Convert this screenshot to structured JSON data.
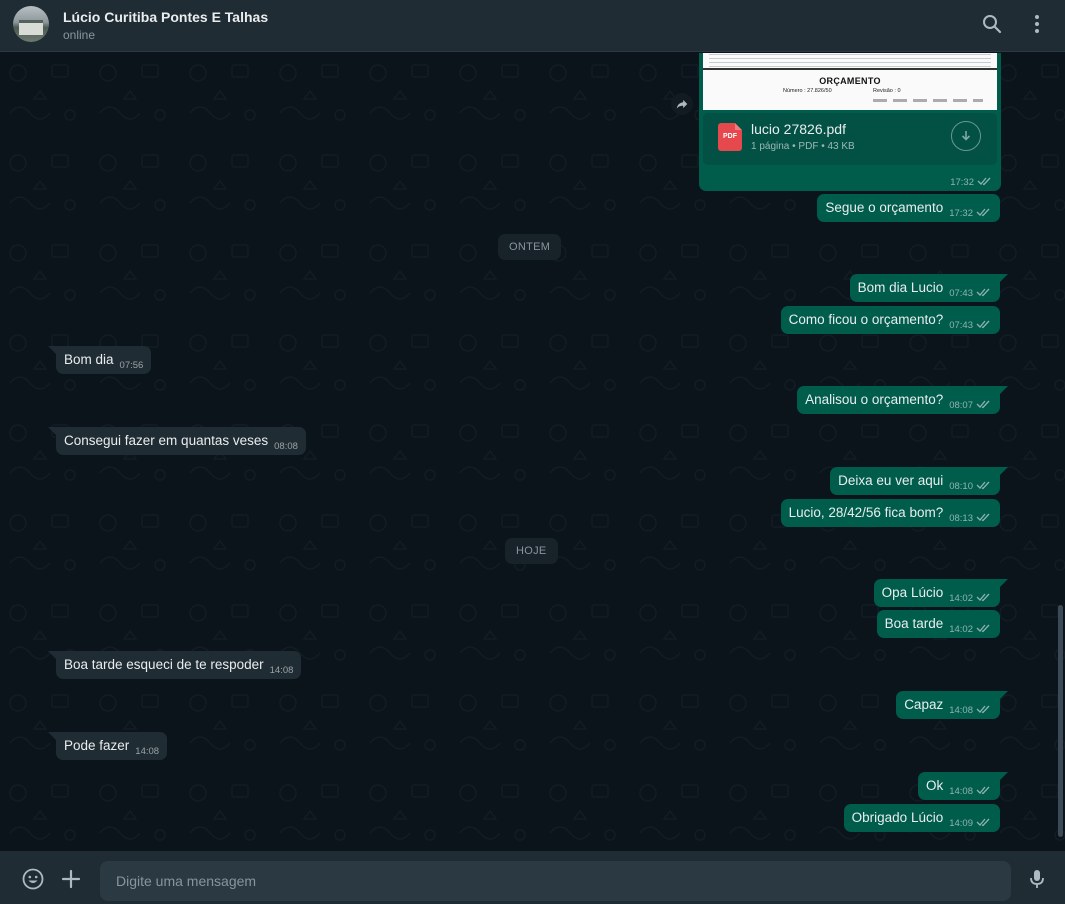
{
  "header": {
    "contact_name": "Lúcio Curitiba Pontes E Talhas",
    "contact_status": "online",
    "icons": [
      "search-icon",
      "menu-icon"
    ]
  },
  "colors": {
    "background": "#0b141a",
    "header": "#202c33",
    "outgoing_bubble": "#005c4b",
    "incoming_bubble": "#202c33",
    "read_ticks": "#53bdeb"
  },
  "document": {
    "preview_title": "ORÇAMENTO",
    "preview_number_label": "Número :",
    "preview_number": "27.826/50",
    "preview_revision_label": "Revisão :",
    "preview_revision": "0",
    "file_name": "lucio 27826.pdf",
    "file_info": "1 página • PDF • 43 KB",
    "icon_label": "PDF",
    "time": "17:32"
  },
  "messages": [
    {
      "text": "Segue o orçamento",
      "time": "17:32",
      "direction": "out"
    },
    {
      "text": "Bom dia Lucio",
      "time": "07:43",
      "direction": "out"
    },
    {
      "text": "Como ficou o orçamento?",
      "time": "07:43",
      "direction": "out"
    },
    {
      "text": "Bom dia",
      "time": "07:56",
      "direction": "in"
    },
    {
      "text": "Analisou o orçamento?",
      "time": "08:07",
      "direction": "out"
    },
    {
      "text": "Consegui fazer em quantas veses",
      "time": "08:08",
      "direction": "in"
    },
    {
      "text": "Deixa eu ver aqui",
      "time": "08:10",
      "direction": "out"
    },
    {
      "text": "Lucio, 28/42/56 fica bom?",
      "time": "08:13",
      "direction": "out"
    },
    {
      "text": "Opa Lúcio",
      "time": "14:02",
      "direction": "out"
    },
    {
      "text": "Boa tarde",
      "time": "14:02",
      "direction": "out"
    },
    {
      "text": "Boa tarde esqueci de te respoder",
      "time": "14:08",
      "direction": "in"
    },
    {
      "text": "Capaz",
      "time": "14:08",
      "direction": "out"
    },
    {
      "text": "Pode fazer",
      "time": "14:08",
      "direction": "in"
    },
    {
      "text": "Ok",
      "time": "14:08",
      "direction": "out"
    },
    {
      "text": "Obrigado Lúcio",
      "time": "14:09",
      "direction": "out"
    }
  ],
  "date_separators": [
    "ONTEM",
    "HOJE"
  ],
  "composer": {
    "placeholder": "Digite uma mensagem",
    "icons": [
      "emoji-icon",
      "attach-icon",
      "microphone-icon"
    ]
  }
}
